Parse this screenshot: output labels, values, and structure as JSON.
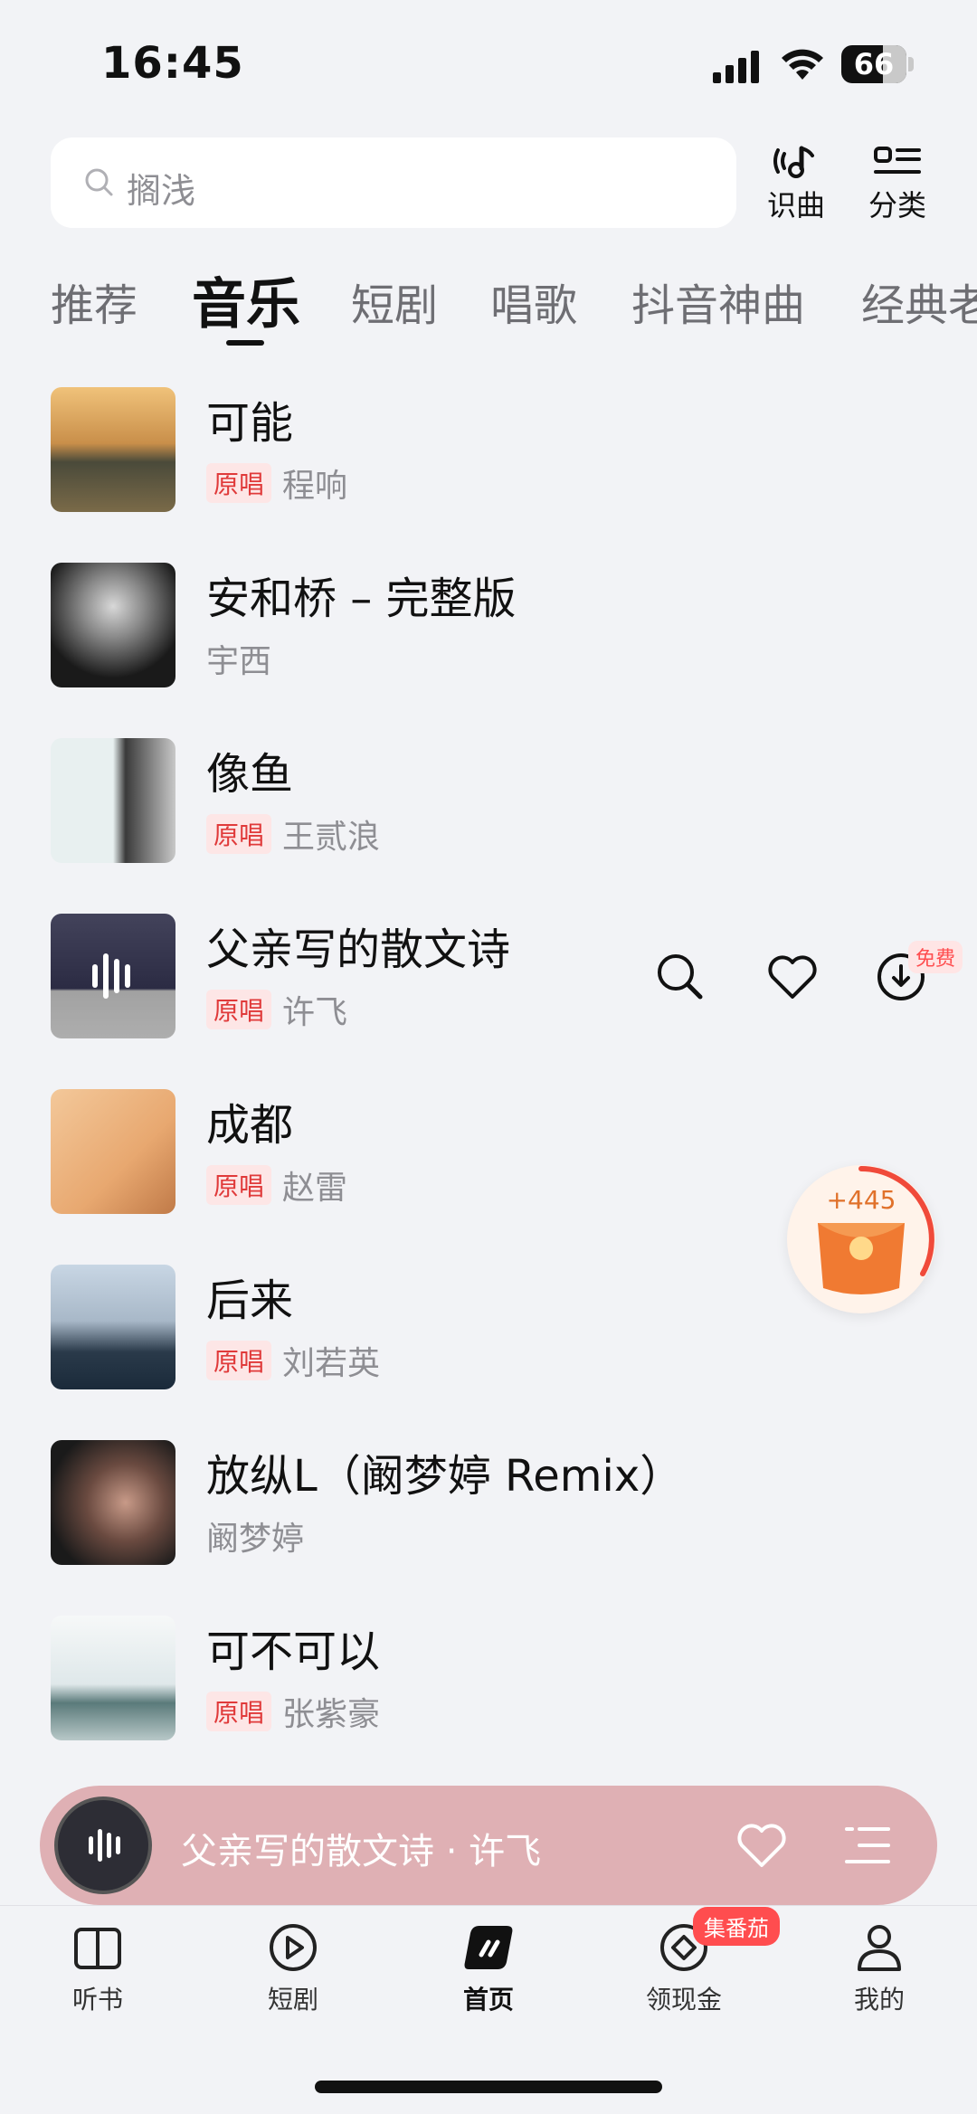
{
  "status_bar": {
    "time": "16:45",
    "battery": "66"
  },
  "search": {
    "placeholder": "搁浅"
  },
  "top_actions": [
    {
      "label": "识曲",
      "icon": "music-recognize-icon"
    },
    {
      "label": "分类",
      "icon": "category-icon"
    }
  ],
  "tabs": [
    "推荐",
    "音乐",
    "短剧",
    "唱歌",
    "抖音神曲",
    "经典老"
  ],
  "active_tab": "音乐",
  "songs": [
    {
      "title": "可能",
      "badge": "原唱",
      "artist": "程响"
    },
    {
      "title": "安和桥 – 完整版",
      "badge": "",
      "artist": "宇西"
    },
    {
      "title": "像鱼",
      "badge": "原唱",
      "artist": "王贰浪"
    },
    {
      "title": "父亲写的散文诗",
      "badge": "原唱",
      "artist": "许飞"
    },
    {
      "title": "成都",
      "badge": "原唱",
      "artist": "赵雷"
    },
    {
      "title": "后来",
      "badge": "原唱",
      "artist": "刘若英"
    },
    {
      "title": "放纵L（阚梦婷 Remix）",
      "badge": "",
      "artist": "阚梦婷"
    },
    {
      "title": "可不可以",
      "badge": "原唱",
      "artist": "张紫豪"
    }
  ],
  "row_actions": {
    "free_badge": "免费"
  },
  "reward": {
    "value": "+445"
  },
  "player": {
    "now_playing": "父亲写的散文诗 · 许飞"
  },
  "bottom_nav": [
    {
      "label": "听书",
      "icon": "book-icon"
    },
    {
      "label": "短剧",
      "icon": "play-icon"
    },
    {
      "label": "首页",
      "icon": "home-icon"
    },
    {
      "label": "领现金",
      "icon": "cash-icon"
    },
    {
      "label": "我的",
      "icon": "profile-icon"
    }
  ],
  "nav_badge": "集番茄",
  "colors": {
    "accent_red": "#e03a3a",
    "player_bg": "#dfb0b4",
    "badge_bg": "#fde6e6"
  }
}
